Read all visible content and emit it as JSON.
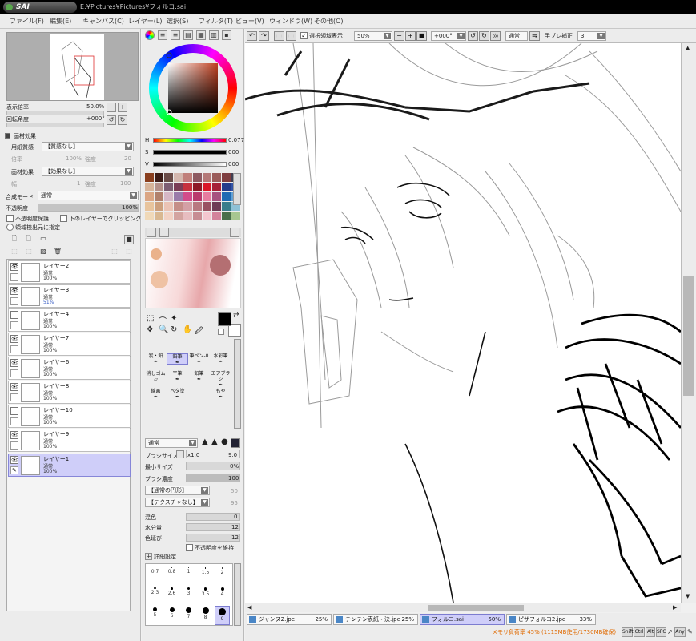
{
  "app": {
    "logo": "SAI",
    "title_path": "E:¥Pictures¥Pictures¥フォルコ.sai"
  },
  "menu": [
    "ファイル(F)",
    "編集(E)",
    "キャンバス(C)",
    "レイヤー(L)",
    "選択(S)",
    "フィルタ(T)",
    "ビュー(V)",
    "ウィンドウ(W)",
    "その他(O)"
  ],
  "navigator": {
    "zoom_label": "表示倍率",
    "zoom_value": "50.0%",
    "rotate_label": "回転角度",
    "rotate_value": "+000°"
  },
  "paper_effect": {
    "header": "画材効果",
    "texture_label": "用紙質感",
    "texture_value": "【質感なし】",
    "scale_label": "倍率",
    "scale_value": "100%",
    "strength_label": "強度",
    "strength_value": "20",
    "effect_label": "画材効果",
    "effect_value": "【効果なし】",
    "width_label": "幅",
    "width_value": "1",
    "effect_strength_label": "強度",
    "effect_strength_value": "100"
  },
  "layer_props": {
    "blend_label": "合成モード",
    "blend_value": "通常",
    "opacity_label": "不透明度",
    "opacity_value": "100%",
    "opacity_fraction": 1.0,
    "protect_opacity": "不透明度保護",
    "clip_below": "下のレイヤーでクリッピング",
    "selection_source": "領域検出元に指定"
  },
  "layers": [
    {
      "name": "レイヤー2",
      "mode": "通常",
      "opacity": "100%",
      "visible": true,
      "selected": false
    },
    {
      "name": "レイヤー3",
      "mode": "通常",
      "opacity": "51%",
      "visible": true,
      "selected": false
    },
    {
      "name": "レイヤー4",
      "mode": "通常",
      "opacity": "100%",
      "visible": false,
      "selected": false
    },
    {
      "name": "レイヤー7",
      "mode": "通常",
      "opacity": "100%",
      "visible": true,
      "selected": false
    },
    {
      "name": "レイヤー6",
      "mode": "通常",
      "opacity": "100%",
      "visible": true,
      "selected": false
    },
    {
      "name": "レイヤー8",
      "mode": "通常",
      "opacity": "100%",
      "visible": true,
      "selected": false
    },
    {
      "name": "レイヤー10",
      "mode": "通常",
      "opacity": "100%",
      "visible": false,
      "selected": false
    },
    {
      "name": "レイヤー9",
      "mode": "通常",
      "opacity": "100%",
      "visible": true,
      "selected": false
    },
    {
      "name": "レイヤー1",
      "mode": "通常",
      "opacity": "100%",
      "visible": true,
      "selected": true
    }
  ],
  "color": {
    "h_label": "H",
    "h_value": "0.077",
    "s_label": "S",
    "s_value": "000",
    "v_label": "V",
    "v_value": "000",
    "primary": "#000000",
    "secondary": "#ffffff",
    "swatches": [
      "#8a3f1e",
      "#3b1b16",
      "#6a4b47",
      "#d4b7ae",
      "#c1807b",
      "#8e5a61",
      "#b47877",
      "#9b5c5a",
      "#7f3d3f",
      "#403e50",
      "#d7b49a",
      "#b49089",
      "#7d5e73",
      "#7b3d56",
      "#c6313e",
      "#8e1a28",
      "#d91729",
      "#a52037",
      "#223c8c",
      "#3253a6",
      "#dba684",
      "#b1806c",
      "#d6b7c5",
      "#9b7baa",
      "#d34c8a",
      "#b93a6c",
      "#e77c9f",
      "#a7527f",
      "#1e6ab3",
      "#61a0d5",
      "#e8c49d",
      "#cda07e",
      "#ebc3b5",
      "#c58e88",
      "#d4a0a5",
      "#b87980",
      "#9a5262",
      "#6f3c55",
      "#3a7d8c",
      "#8ec1d6",
      "#f0d9b8",
      "#d9b891",
      "#f2d2c4",
      "#d3a4a0",
      "#e7bdc0",
      "#c78c93",
      "#f4c6cf",
      "#d3839b",
      "#496f4b",
      "#a7c690"
    ]
  },
  "tools": {
    "brush_names": [
      "鉛筆",
      "ペン",
      "エアブラシ",
      "水彩筆",
      "筆",
      "ブラシ",
      "消しゴム",
      "選択ペン",
      "選択消し",
      "バケツ",
      "マーカー",
      "ぼかし"
    ],
    "brushes": [
      {
        "name": "炭・鉛"
      },
      {
        "name": "鉛筆"
      },
      {
        "name": "筆ペン-0"
      },
      {
        "name": "水彩筆"
      },
      {
        "name": "消しゴム"
      },
      {
        "name": "平筆"
      },
      {
        "name": "鉛筆"
      },
      {
        "name": "エアブラシ"
      },
      {
        "name": "線画"
      },
      {
        "name": "ベタ塗"
      },
      {
        "name": ""
      },
      {
        "name": "もや"
      }
    ],
    "blend_value": "通常",
    "brush_size_label": "ブラシサイズ",
    "brush_size_mult": "x1.0",
    "brush_size_value": "9.0",
    "min_size_label": "最小サイズ",
    "min_size_value": "0%",
    "density_label": "ブラシ濃度",
    "density_value": "100",
    "shape_value": "【通常の円形】",
    "texture_value": "【テクスチャなし】",
    "shape_num": "50",
    "texture_num": "95",
    "mix_label": "混色",
    "mix_value": "0",
    "water_label": "水分量",
    "water_value": "12",
    "stretch_label": "色延び",
    "stretch_value": "12",
    "keep_opacity": "不透明度を維持",
    "detail_label": "詳細設定",
    "size_dots": [
      "0.7",
      "0.8",
      "1",
      "1.5",
      "2",
      "2.3",
      "2.6",
      "3",
      "3.5",
      "4",
      "5",
      "6",
      "7",
      "8",
      "9"
    ]
  },
  "toolbar": {
    "selection_display": "選択領域表示",
    "zoom_value": "50%",
    "rotate_value": "+000°",
    "blend_value": "通常",
    "stabilizer_label": "手ブレ補正",
    "stabilizer_value": "3"
  },
  "tabs": [
    {
      "name": "ジャンヌ2.jpe",
      "zoom": "25%",
      "active": false
    },
    {
      "name": "テンテン表紙・決.jpe",
      "zoom": "25%",
      "active": false
    },
    {
      "name": "フォルコ.sai",
      "zoom": "50%",
      "active": true
    },
    {
      "name": "ピザフォルコ2.jpe",
      "zoom": "33%",
      "active": false
    }
  ],
  "status": {
    "memory": "メモリ負荷率 45% (1115MB使用/1730MB確保)",
    "keys": [
      "Shift",
      "Ctrl",
      "Alt",
      "SPC",
      "Any"
    ]
  }
}
